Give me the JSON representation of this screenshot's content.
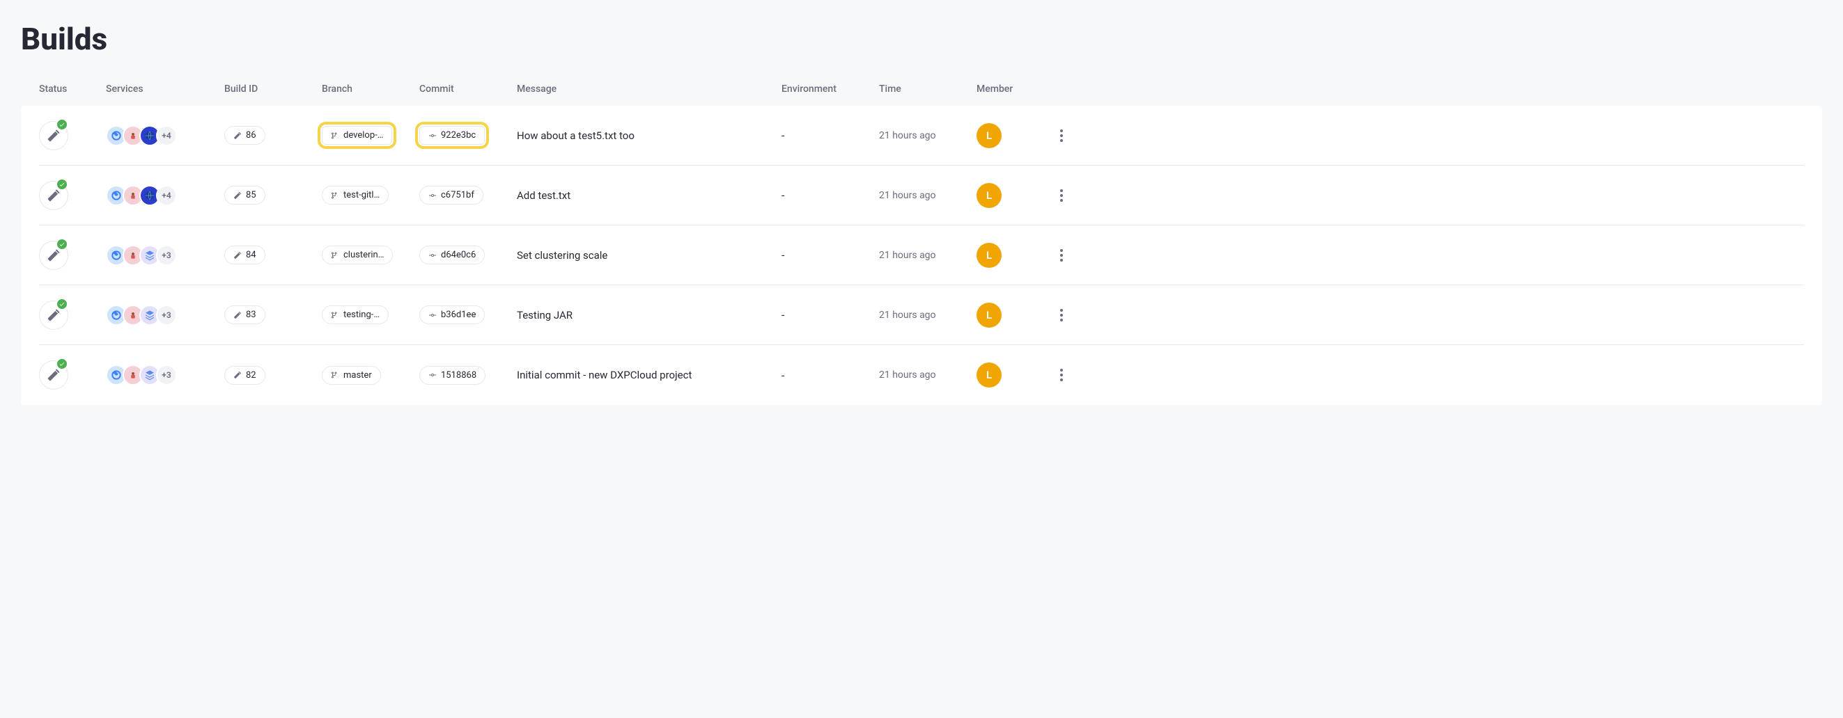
{
  "title": "Builds",
  "columns": {
    "status": "Status",
    "services": "Services",
    "build_id": "Build ID",
    "branch": "Branch",
    "commit": "Commit",
    "message": "Message",
    "environment": "Environment",
    "time": "Time",
    "member": "Member"
  },
  "rows": [
    {
      "extra_services": "+4",
      "build_id": "86",
      "branch": "develop-…",
      "commit": "922e3bc",
      "message": "How about a test5.txt too",
      "environment": "-",
      "time": "21 hours ago",
      "member_initial": "L",
      "highlight": true,
      "svc_variant": "darkblue"
    },
    {
      "extra_services": "+4",
      "build_id": "85",
      "branch": "test-gitl…",
      "commit": "c6751bf",
      "message": "Add test.txt",
      "environment": "-",
      "time": "21 hours ago",
      "member_initial": "L",
      "highlight": false,
      "svc_variant": "darkblue"
    },
    {
      "extra_services": "+3",
      "build_id": "84",
      "branch": "clusterin…",
      "commit": "d64e0c6",
      "message": "Set clustering scale",
      "environment": "-",
      "time": "21 hours ago",
      "member_initial": "L",
      "highlight": false,
      "svc_variant": "stack"
    },
    {
      "extra_services": "+3",
      "build_id": "83",
      "branch": "testing-…",
      "commit": "b36d1ee",
      "message": "Testing JAR",
      "environment": "-",
      "time": "21 hours ago",
      "member_initial": "L",
      "highlight": false,
      "svc_variant": "stack"
    },
    {
      "extra_services": "+3",
      "build_id": "82",
      "branch": "master",
      "commit": "1518868",
      "message": "Initial commit - new DXPCloud project",
      "environment": "-",
      "time": "21 hours ago",
      "member_initial": "L",
      "highlight": false,
      "svc_variant": "stack"
    }
  ]
}
